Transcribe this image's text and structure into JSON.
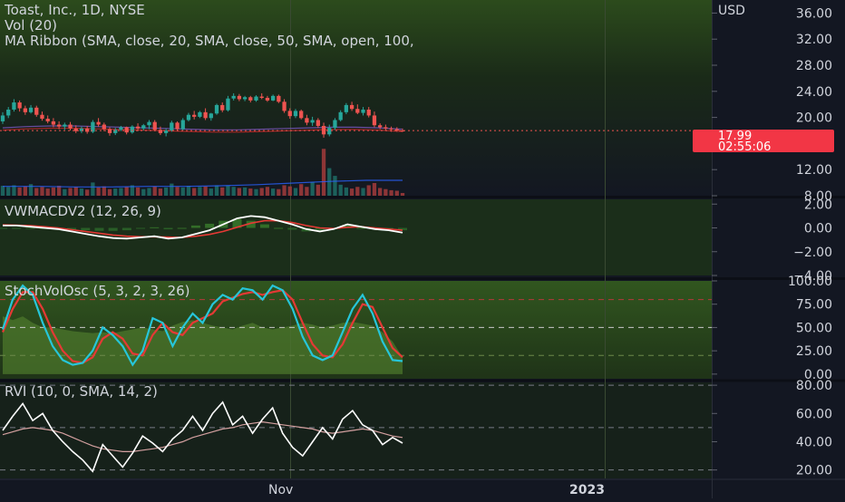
{
  "header": {
    "title": "Toast, Inc., 1D, NYSE",
    "vol_label": "Vol (20)",
    "ribbon_label": "MA Ribbon (SMA, close, 20, SMA, close, 50, SMA, open, 100,"
  },
  "currency": "USD",
  "price_badge": {
    "price": "17.99",
    "countdown": "02:55:06"
  },
  "colors": {
    "bull": "#26a69a",
    "bear": "#ef5350",
    "macd": "#ffffff",
    "signal": "#e53935",
    "stoch_k": "#26c6da",
    "stoch_d": "#e53935",
    "rvi": "#ffffff",
    "rvi_ma": "#d4a0a0",
    "badge": "#f23645"
  },
  "time_axis": {
    "labels": [
      "Nov",
      "2023"
    ]
  },
  "chart_data": [
    {
      "type": "candlestick",
      "name": "price",
      "y_ticks": [
        "36.00",
        "32.00",
        "28.00",
        "24.00",
        "20.00",
        "12.00",
        "8.00"
      ],
      "ylim": [
        8,
        38
      ],
      "last_price": 17.99,
      "candles": [
        [
          19.4,
          20.8,
          19.0,
          20.3
        ],
        [
          20.3,
          21.6,
          19.9,
          21.2
        ],
        [
          21.2,
          22.8,
          20.9,
          22.3
        ],
        [
          22.3,
          22.6,
          20.9,
          21.4
        ],
        [
          21.4,
          21.8,
          20.4,
          20.8
        ],
        [
          20.8,
          21.9,
          20.6,
          21.5
        ],
        [
          21.5,
          21.8,
          20.1,
          20.4
        ],
        [
          20.4,
          20.9,
          19.5,
          19.8
        ],
        [
          19.8,
          20.3,
          19.1,
          19.4
        ],
        [
          19.4,
          19.9,
          18.5,
          18.9
        ],
        [
          18.9,
          19.4,
          18.2,
          18.6
        ],
        [
          18.6,
          19.2,
          18.1,
          18.9
        ],
        [
          18.9,
          19.3,
          18.0,
          18.3
        ],
        [
          18.3,
          18.8,
          17.6,
          17.9
        ],
        [
          17.9,
          18.6,
          17.6,
          18.3
        ],
        [
          18.3,
          18.7,
          17.5,
          17.8
        ],
        [
          17.8,
          19.6,
          17.6,
          19.3
        ],
        [
          19.3,
          19.9,
          18.6,
          18.9
        ],
        [
          18.9,
          19.2,
          17.9,
          18.2
        ],
        [
          18.2,
          18.5,
          17.2,
          17.6
        ],
        [
          17.6,
          18.4,
          17.3,
          18.1
        ],
        [
          18.1,
          18.7,
          17.9,
          18.5
        ],
        [
          18.5,
          18.6,
          17.4,
          17.7
        ],
        [
          17.7,
          18.8,
          17.5,
          18.6
        ],
        [
          18.6,
          19.1,
          17.9,
          18.3
        ],
        [
          18.3,
          19.0,
          18.0,
          18.8
        ],
        [
          18.8,
          19.6,
          18.2,
          19.3
        ],
        [
          19.3,
          19.6,
          17.9,
          18.1
        ],
        [
          18.1,
          18.6,
          17.3,
          17.6
        ],
        [
          17.6,
          18.3,
          17.1,
          18.0
        ],
        [
          18.0,
          19.5,
          17.8,
          19.2
        ],
        [
          19.2,
          19.4,
          17.9,
          18.2
        ],
        [
          18.2,
          19.9,
          18.0,
          19.6
        ],
        [
          19.6,
          20.7,
          19.4,
          20.4
        ],
        [
          20.4,
          21.0,
          19.7,
          20.1
        ],
        [
          20.1,
          21.0,
          19.9,
          20.8
        ],
        [
          20.8,
          21.4,
          19.6,
          19.9
        ],
        [
          19.9,
          20.7,
          19.5,
          20.6
        ],
        [
          20.6,
          22.1,
          20.4,
          21.9
        ],
        [
          21.9,
          22.3,
          20.8,
          21.1
        ],
        [
          21.1,
          23.3,
          20.9,
          22.9
        ],
        [
          22.9,
          23.7,
          22.6,
          23.3
        ],
        [
          23.3,
          23.6,
          22.5,
          22.8
        ],
        [
          22.8,
          23.3,
          22.5,
          23.1
        ],
        [
          23.1,
          23.3,
          22.3,
          22.6
        ],
        [
          22.6,
          23.4,
          22.4,
          23.2
        ],
        [
          23.2,
          23.7,
          22.8,
          23.0
        ],
        [
          23.0,
          23.3,
          22.4,
          22.6
        ],
        [
          22.6,
          23.5,
          22.5,
          23.3
        ],
        [
          23.3,
          23.5,
          22.2,
          22.4
        ],
        [
          22.4,
          22.8,
          20.7,
          21.0
        ],
        [
          21.0,
          21.4,
          19.8,
          20.2
        ],
        [
          20.2,
          21.3,
          19.9,
          21.0
        ],
        [
          21.0,
          21.2,
          19.7,
          19.9
        ],
        [
          19.9,
          20.4,
          18.8,
          19.2
        ],
        [
          19.2,
          20.1,
          18.7,
          19.6
        ],
        [
          19.6,
          19.9,
          18.4,
          18.7
        ],
        [
          18.7,
          19.2,
          16.9,
          17.4
        ],
        [
          17.4,
          18.9,
          17.1,
          18.4
        ],
        [
          18.4,
          19.9,
          18.1,
          19.6
        ],
        [
          19.6,
          21.1,
          19.4,
          20.8
        ],
        [
          20.8,
          22.2,
          20.5,
          21.9
        ],
        [
          21.9,
          22.4,
          21.0,
          21.3
        ],
        [
          21.3,
          22.0,
          20.5,
          20.7
        ],
        [
          20.7,
          21.6,
          20.3,
          21.2
        ],
        [
          21.2,
          21.6,
          20.0,
          20.3
        ],
        [
          20.3,
          20.9,
          18.5,
          18.8
        ],
        [
          18.8,
          19.1,
          18.2,
          18.5
        ],
        [
          18.5,
          18.9,
          18.0,
          18.3
        ],
        [
          18.3,
          18.6,
          17.8,
          18.2
        ],
        [
          18.2,
          18.5,
          17.8,
          18.0
        ],
        [
          18.0,
          18.3,
          17.8,
          17.99
        ]
      ],
      "ribbon": [
        18.4,
        18.6,
        18.7,
        18.7,
        18.6,
        18.5,
        18.4,
        18.3,
        18.2,
        18.1,
        18.1,
        18.2,
        18.3,
        18.4,
        18.5,
        18.5,
        18.4,
        18.2
      ]
    },
    {
      "type": "bar",
      "name": "volume",
      "values": [
        1.8,
        1.6,
        1.9,
        1.5,
        1.7,
        2.1,
        1.4,
        1.6,
        1.3,
        1.5,
        1.8,
        1.2,
        1.4,
        1.6,
        1.3,
        1.1,
        2.4,
        1.5,
        1.7,
        1.2,
        1.3,
        1.4,
        1.6,
        1.9,
        1.5,
        1.2,
        1.4,
        1.7,
        1.3,
        1.5,
        2.2,
        1.6,
        1.5,
        1.8,
        1.4,
        1.6,
        1.7,
        1.3,
        1.9,
        1.5,
        1.8,
        1.6,
        1.4,
        1.5,
        1.3,
        1.2,
        1.4,
        1.6,
        1.3,
        1.2,
        1.9,
        1.7,
        1.4,
        2.1,
        1.6,
        2.5,
        2.0,
        8.5,
        5.0,
        3.6,
        2.0,
        1.5,
        1.3,
        1.6,
        1.4,
        1.9,
        2.3,
        1.4,
        1.2,
        1.0,
        0.9,
        0.5
      ],
      "average": [
        1.7,
        1.7,
        1.6,
        1.6,
        1.7,
        1.7,
        1.8,
        2.0,
        2.3,
        2.6,
        2.8,
        2.8
      ]
    },
    {
      "type": "line",
      "name": "VWMACDV2",
      "legend": "VWMACDV2 (12, 26, 9)",
      "y_ticks": [
        "2.00",
        "0.00",
        "−2.00",
        "−4.00"
      ],
      "ylim": [
        -4,
        2.4
      ],
      "macd": [
        0.2,
        0.2,
        0.1,
        0.0,
        -0.1,
        -0.3,
        -0.5,
        -0.7,
        -0.85,
        -0.9,
        -0.8,
        -0.7,
        -0.9,
        -0.8,
        -0.5,
        -0.2,
        0.3,
        0.8,
        1.0,
        0.9,
        0.6,
        0.3,
        -0.1,
        -0.3,
        -0.1,
        0.3,
        0.1,
        -0.1,
        -0.2,
        -0.4
      ],
      "signal": [
        0.25,
        0.22,
        0.18,
        0.1,
        0.0,
        -0.15,
        -0.3,
        -0.45,
        -0.6,
        -0.7,
        -0.75,
        -0.75,
        -0.78,
        -0.8,
        -0.7,
        -0.55,
        -0.3,
        0.05,
        0.4,
        0.6,
        0.6,
        0.45,
        0.2,
        0.0,
        -0.05,
        0.05,
        0.1,
        0.0,
        -0.1,
        -0.2
      ]
    },
    {
      "type": "line",
      "name": "StochVolOsc",
      "legend": "StochVolOsc (5, 3, 2, 3, 26)",
      "y_ticks": [
        "100.00",
        "75.00",
        "50.00",
        "25.00",
        "0.00"
      ],
      "ylim": [
        -5,
        100
      ],
      "levels": [
        80,
        50,
        20
      ],
      "k": [
        48,
        80,
        95,
        85,
        55,
        30,
        15,
        10,
        12,
        25,
        50,
        42,
        30,
        10,
        25,
        60,
        55,
        30,
        50,
        65,
        55,
        75,
        85,
        80,
        92,
        90,
        80,
        95,
        90,
        70,
        40,
        20,
        15,
        20,
        45,
        70,
        85,
        65,
        35,
        15,
        14
      ],
      "d": [
        45,
        70,
        88,
        88,
        70,
        45,
        25,
        14,
        12,
        18,
        38,
        45,
        38,
        22,
        20,
        42,
        55,
        45,
        42,
        55,
        60,
        65,
        78,
        82,
        86,
        88,
        85,
        88,
        90,
        80,
        55,
        32,
        20,
        18,
        32,
        55,
        75,
        72,
        50,
        28,
        18
      ],
      "fill": [
        62,
        58,
        62,
        55,
        50,
        50,
        48,
        46,
        45,
        44,
        45,
        44,
        46,
        48,
        50,
        48,
        46,
        52,
        56,
        58,
        55,
        52,
        50,
        48,
        52,
        55,
        50,
        48,
        50,
        52,
        55,
        53,
        50,
        52,
        55,
        56,
        54,
        52,
        45,
        35,
        18
      ]
    },
    {
      "type": "line",
      "name": "RVI",
      "legend": "RVI (10, 0, SMA, 14, 2)",
      "y_ticks": [
        "80.00",
        "60.00",
        "40.00",
        "20.00"
      ],
      "ylim": [
        14,
        82
      ],
      "levels": [
        80,
        50,
        20
      ],
      "rvi": [
        48,
        58,
        67,
        55,
        60,
        48,
        40,
        33,
        27,
        19,
        38,
        30,
        22,
        32,
        44,
        39,
        33,
        42,
        48,
        58,
        48,
        60,
        68,
        52,
        58,
        46,
        56,
        64,
        46,
        36,
        30,
        40,
        50,
        42,
        56,
        62,
        52,
        48,
        38,
        43,
        39
      ],
      "ma": [
        45,
        47,
        49,
        50,
        49,
        48,
        46,
        43,
        40,
        37,
        35,
        34,
        33,
        33,
        34,
        35,
        36,
        38,
        40,
        43,
        45,
        47,
        49,
        50,
        52,
        53,
        54,
        53,
        52,
        51,
        50,
        49,
        47,
        46,
        47,
        48,
        49,
        48,
        46,
        44,
        43
      ]
    }
  ]
}
